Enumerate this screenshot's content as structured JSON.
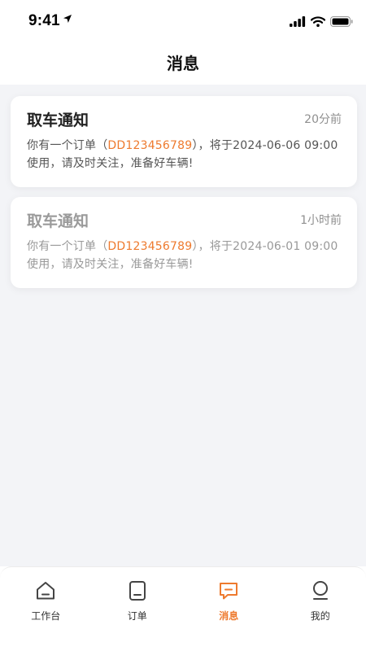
{
  "status_bar": {
    "time": "9:41"
  },
  "header": {
    "title": "消息"
  },
  "messages": [
    {
      "title": "取车通知",
      "time": "20分前",
      "text_before": "你有一个订单（",
      "order_no": "DD123456789",
      "text_after": "），将于2024-06-06 09:00使用，请及时关注，准备好车辆!",
      "read": false
    },
    {
      "title": "取车通知",
      "time": "1小时前",
      "text_before": "你有一个订单（",
      "order_no": "DD123456789",
      "text_after": "），将于2024-06-01 09:00使用，请及时关注，准备好车辆!",
      "read": true
    }
  ],
  "tabs": [
    {
      "label": "工作台",
      "icon": "home-icon"
    },
    {
      "label": "订单",
      "icon": "order-icon"
    },
    {
      "label": "消息",
      "icon": "message-icon",
      "active": true
    },
    {
      "label": "我的",
      "icon": "profile-icon"
    }
  ],
  "colors": {
    "accent": "#ee7a2e",
    "background": "#f3f4f7"
  }
}
